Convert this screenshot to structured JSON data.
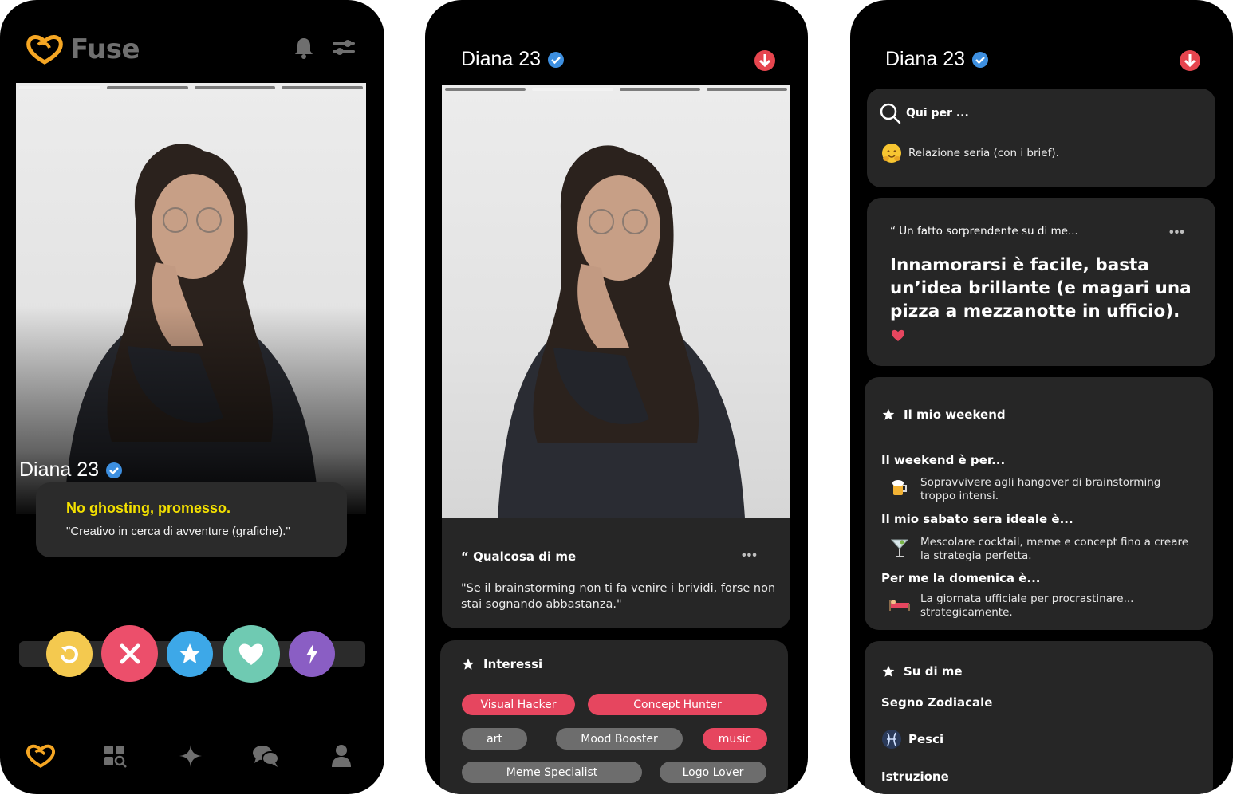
{
  "phone1": {
    "app_name": "Fuse",
    "profile": {
      "name": "Diana 23"
    },
    "tagline": {
      "title": "No ghosting, promesso.",
      "text": "\"Creativo in cerca di avventure (grafiche).\""
    },
    "actions": [
      "rewind-icon",
      "nope-icon",
      "super-like-icon",
      "like-icon",
      "boost-icon"
    ],
    "nav": [
      "fuse-logo-icon",
      "explore-icon",
      "sparkle-icon",
      "chat-icon",
      "profile-icon"
    ],
    "colors": {
      "accent": "#f5a623",
      "tagline_title": "#f3e000",
      "rewind": "#f4c94f",
      "nope": "#ec4f6b",
      "star": "#3da8e8",
      "like": "#6fcab2",
      "boost": "#8a5ec4"
    }
  },
  "phone2": {
    "profile": {
      "name": "Diana 23"
    },
    "about": {
      "title": "“ Qualcosa di me",
      "menu": "•••",
      "text": "\"Se il brainstorming non ti fa venire i brividi, forse non stai sognando abbastanza.\""
    },
    "interests": {
      "title": "Interessi",
      "chips": [
        "Visual Hacker",
        "Concept Hunter",
        "art",
        "Mood Booster",
        "music",
        "Meme Specialist",
        "Logo Lover"
      ]
    }
  },
  "phone3": {
    "profile": {
      "name": "Diana 23"
    },
    "looking_for": {
      "title": "Qui per ...",
      "value": "Relazione seria (con i brief)."
    },
    "fact": {
      "title": "“ Un fatto sorprendente su di me...",
      "menu": "•••",
      "text": "Innamorarsi è facile, basta un’idea brillante (e magari una pizza a mezzanotte in ufficio)."
    },
    "weekend": {
      "title": "Il mio weekend",
      "sections": [
        {
          "label": "Il weekend è per...",
          "icon": "beer-icon",
          "text": "Sopravvivere agli hangover di brainstorming troppo intensi."
        },
        {
          "label": "Il mio sabato sera ideale è...",
          "icon": "cocktail-icon",
          "text": "Mescolare cocktail, meme e concept fino a creare la strategia perfetta."
        },
        {
          "label": "Per me la domenica è...",
          "icon": "bed-icon",
          "text": "La giornata ufficiale per procrastinare... strategicamente."
        }
      ]
    },
    "about_me": {
      "title": "Su di me",
      "zodiac_label": "Segno Zodiacale",
      "zodiac_value": "Pesci",
      "education_label": "Istruzione"
    }
  }
}
